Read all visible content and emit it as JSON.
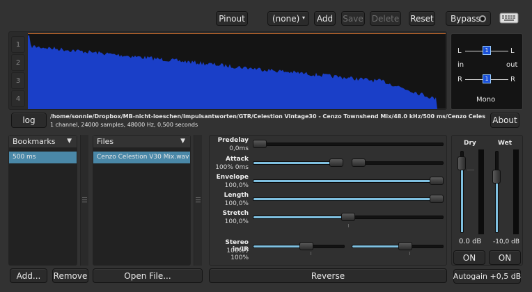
{
  "toolbar": {
    "pinout_label": "Pinout",
    "preset_value": "(none)",
    "add_label": "Add",
    "save_label": "Save",
    "delete_label": "Delete",
    "reset_label": "Reset",
    "bypass_label": "Bypass"
  },
  "waveform": {
    "channel_numbers": [
      "1",
      "2",
      "3",
      "4"
    ],
    "color": "#1a3fc8"
  },
  "routing": {
    "left": "L",
    "right": "R",
    "in_label": "in",
    "out_label": "out",
    "l_channel": "1",
    "r_channel": "1",
    "mode": "Mono"
  },
  "file_info": {
    "log_label": "log",
    "path": "/home/sonnie/Dropbox/MB-nicht-loeschen/Impulsantworten/GTR/Celestion Vintage30 - Cenzo Townshend Mix/48.0 kHz/500 ms/Cenzo Celestion V30 Mix.wav",
    "details": "1 channel, 24000 samples, 48000 Hz, 0,500 seconds",
    "about_label": "About"
  },
  "bookmarks": {
    "header": "Bookmarks",
    "items": [
      "500 ms"
    ],
    "add_label": "Add...",
    "remove_label": "Remove"
  },
  "files": {
    "header": "Files",
    "items": [
      "Cenzo Celestion V30 Mix.wav"
    ],
    "open_label": "Open File..."
  },
  "params": {
    "predelay": {
      "label": "Predelay",
      "value": "0,0ms",
      "level": 0.0
    },
    "attack": {
      "label": "Attack",
      "value": "100%  0ms",
      "level": 1.0,
      "level2": 0.0
    },
    "envelope": {
      "label": "Envelope",
      "value": "100,0%",
      "level": 1.0
    },
    "length": {
      "label": "Length",
      "value": "100,0%",
      "level": 1.0
    },
    "stretch": {
      "label": "Stretch",
      "value": "100,0%",
      "level": 0.5
    },
    "stereo": {
      "label": "Stereo in/IR",
      "value": "100% / 100%",
      "level": 0.6,
      "level2": 0.6
    },
    "reverse_label": "Reverse"
  },
  "mix": {
    "dry_label": "Dry",
    "wet_label": "Wet",
    "dry_value": "0.0 dB",
    "wet_value": "-10,0 dB",
    "dry_on": "ON",
    "wet_on": "ON",
    "autogain_label": "Autogain +0,5 dB",
    "dry_level": 0.92,
    "wet_level": 0.72
  },
  "accent_color": "#7fc0e0"
}
